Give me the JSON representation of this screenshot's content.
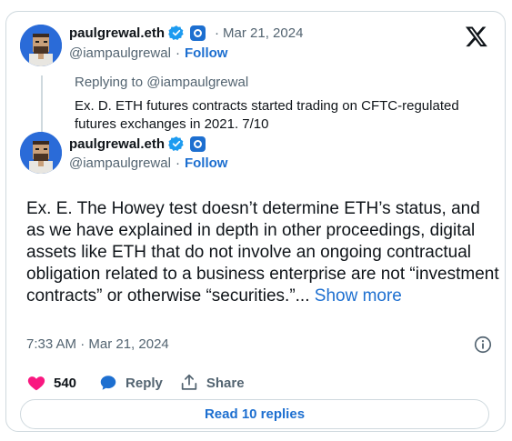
{
  "parent_tweet": {
    "display_name": "paulgrewal.eth",
    "separator": "·",
    "date": "Mar 21, 2024",
    "handle": "@iampaulgrewal",
    "follow_separator": "·",
    "follow_label": "Follow",
    "replying_to": "Replying to @iampaulgrewal",
    "text": "Ex. D. ETH futures contracts started trading on CFTC-regulated futures exchanges in 2021. 7/10"
  },
  "main_tweet": {
    "display_name": "paulgrewal.eth",
    "handle": "@iampaulgrewal",
    "follow_separator": "·",
    "follow_label": "Follow",
    "text": "Ex. E. The Howey test doesn’t determine ETH’s status, and as we have explained in depth in other proceedings, digital assets like ETH that do not involve an ongoing contractual obligation related to a business enterprise are not “investment contracts” or otherwise “securities.”...",
    "show_more": "Show more",
    "timestamp": "7:33 AM · Mar 21, 2024"
  },
  "actions": {
    "like_count": "540",
    "reply_label": "Reply",
    "share_label": "Share",
    "read_replies": "Read 10 replies"
  },
  "icons": {
    "brand": "x-logo-icon",
    "verified": "verified-badge-icon",
    "org": "org-badge-icon",
    "info": "info-icon",
    "like": "heart-icon",
    "reply": "reply-bubble-icon",
    "share": "share-icon"
  },
  "colors": {
    "accent": "#1d6fd0",
    "like": "#f91880",
    "muted": "#536471",
    "avatar_bg": "#2a6bd8"
  }
}
